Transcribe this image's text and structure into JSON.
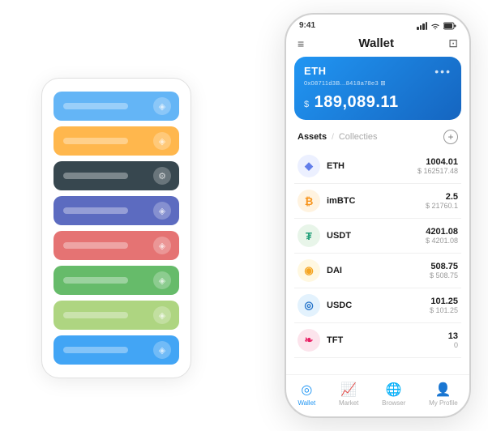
{
  "scene": {
    "cardStack": {
      "cards": [
        {
          "color": "#64b5f6",
          "label": "",
          "icon": "◈"
        },
        {
          "color": "#ffb74d",
          "label": "",
          "icon": "◈"
        },
        {
          "color": "#37474f",
          "label": "",
          "icon": "⚙"
        },
        {
          "color": "#5c6bc0",
          "label": "",
          "icon": "◈"
        },
        {
          "color": "#e57373",
          "label": "",
          "icon": "◈"
        },
        {
          "color": "#66bb6a",
          "label": "",
          "icon": "◈"
        },
        {
          "color": "#aed581",
          "label": "",
          "icon": "◈"
        },
        {
          "color": "#42a5f5",
          "label": "",
          "icon": "◈"
        }
      ]
    },
    "phone": {
      "statusBar": {
        "time": "9:41",
        "signal": "●●●●",
        "wifi": "WiFi",
        "battery": "Battery"
      },
      "header": {
        "menuIcon": "≡",
        "title": "Wallet",
        "expandIcon": "⊡"
      },
      "ethCard": {
        "name": "ETH",
        "address": "0x08711d3B...8418a78e3  ⊞",
        "moreIcon": "•••",
        "currencySymbol": "$",
        "balance": "189,089.11"
      },
      "assetsHeader": {
        "tabActive": "Assets",
        "separator": "/",
        "tabInactive": "Collecties",
        "addIcon": "+"
      },
      "assets": [
        {
          "symbol": "ETH",
          "iconBg": "#ecf0ff",
          "iconColor": "#627eea",
          "iconText": "◆",
          "amount": "1004.01",
          "usd": "$ 162517.48"
        },
        {
          "symbol": "imBTC",
          "iconBg": "#fff3e0",
          "iconColor": "#f7931a",
          "iconText": "₿",
          "amount": "2.5",
          "usd": "$ 21760.1"
        },
        {
          "symbol": "USDT",
          "iconBg": "#e8f5e9",
          "iconColor": "#26a17b",
          "iconText": "₮",
          "amount": "4201.08",
          "usd": "$ 4201.08"
        },
        {
          "symbol": "DAI",
          "iconBg": "#fff8e1",
          "iconColor": "#f5a623",
          "iconText": "◉",
          "amount": "508.75",
          "usd": "$ 508.75"
        },
        {
          "symbol": "USDC",
          "iconBg": "#e3f2fd",
          "iconColor": "#2775ca",
          "iconText": "◎",
          "amount": "101.25",
          "usd": "$ 101.25"
        },
        {
          "symbol": "TFT",
          "iconBg": "#fce4ec",
          "iconColor": "#e91e63",
          "iconText": "❧",
          "amount": "13",
          "usd": "0"
        }
      ],
      "bottomNav": [
        {
          "icon": "◎",
          "label": "Wallet",
          "active": true
        },
        {
          "icon": "📈",
          "label": "Market",
          "active": false
        },
        {
          "icon": "🌐",
          "label": "Browser",
          "active": false
        },
        {
          "icon": "👤",
          "label": "My Profile",
          "active": false
        }
      ]
    }
  }
}
